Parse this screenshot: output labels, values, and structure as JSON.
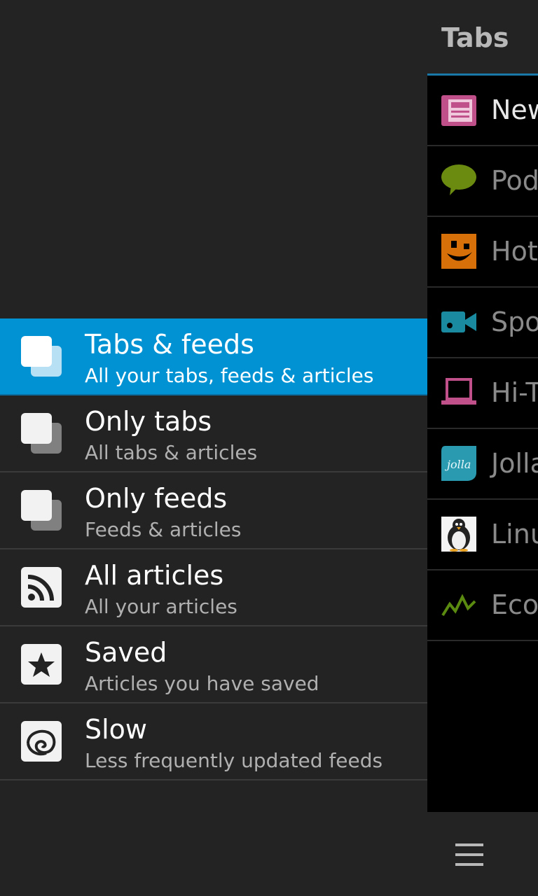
{
  "menu": {
    "items": [
      {
        "title": "Tabs & feeds",
        "subtitle": "All your tabs, feeds & articles",
        "icon": "stacked-squares-icon",
        "selected": true
      },
      {
        "title": "Only tabs",
        "subtitle": "All tabs & articles",
        "icon": "stacked-squares-icon",
        "selected": false
      },
      {
        "title": "Only feeds",
        "subtitle": "Feeds & articles",
        "icon": "stacked-squares-icon",
        "selected": false
      },
      {
        "title": "All articles",
        "subtitle": "All your articles",
        "icon": "rss-icon",
        "selected": false
      },
      {
        "title": "Saved",
        "subtitle": "Articles you have saved",
        "icon": "star-icon",
        "selected": false
      },
      {
        "title": "Slow",
        "subtitle": "Less frequently updated feeds",
        "icon": "nautilus-icon",
        "selected": false
      }
    ]
  },
  "tabs_panel": {
    "title": "Tabs",
    "tabs": [
      {
        "label": "New",
        "icon": "newspaper-icon",
        "color": "#c0508a"
      },
      {
        "label": "Pod",
        "icon": "speech-bubble-icon",
        "color": "#6a8a10"
      },
      {
        "label": "Hot",
        "icon": "smiley-icon",
        "color": "#d8700a"
      },
      {
        "label": "Spo",
        "icon": "video-camera-icon",
        "color": "#1a8aa0"
      },
      {
        "label": "Hi-T",
        "icon": "laptop-icon",
        "color": "#c0508a"
      },
      {
        "label": "Jolla",
        "icon": "jolla-icon",
        "color": "#2a9ab0"
      },
      {
        "label": "Linu",
        "icon": "penguin-icon",
        "color": "#888888"
      },
      {
        "label": "Eco",
        "icon": "chart-line-icon",
        "color": "#5a8a10"
      }
    ],
    "menu_icon": "hamburger-icon"
  },
  "colors": {
    "background": "#232323",
    "accent": "#0092d2",
    "tab_list_bg": "#000000"
  }
}
